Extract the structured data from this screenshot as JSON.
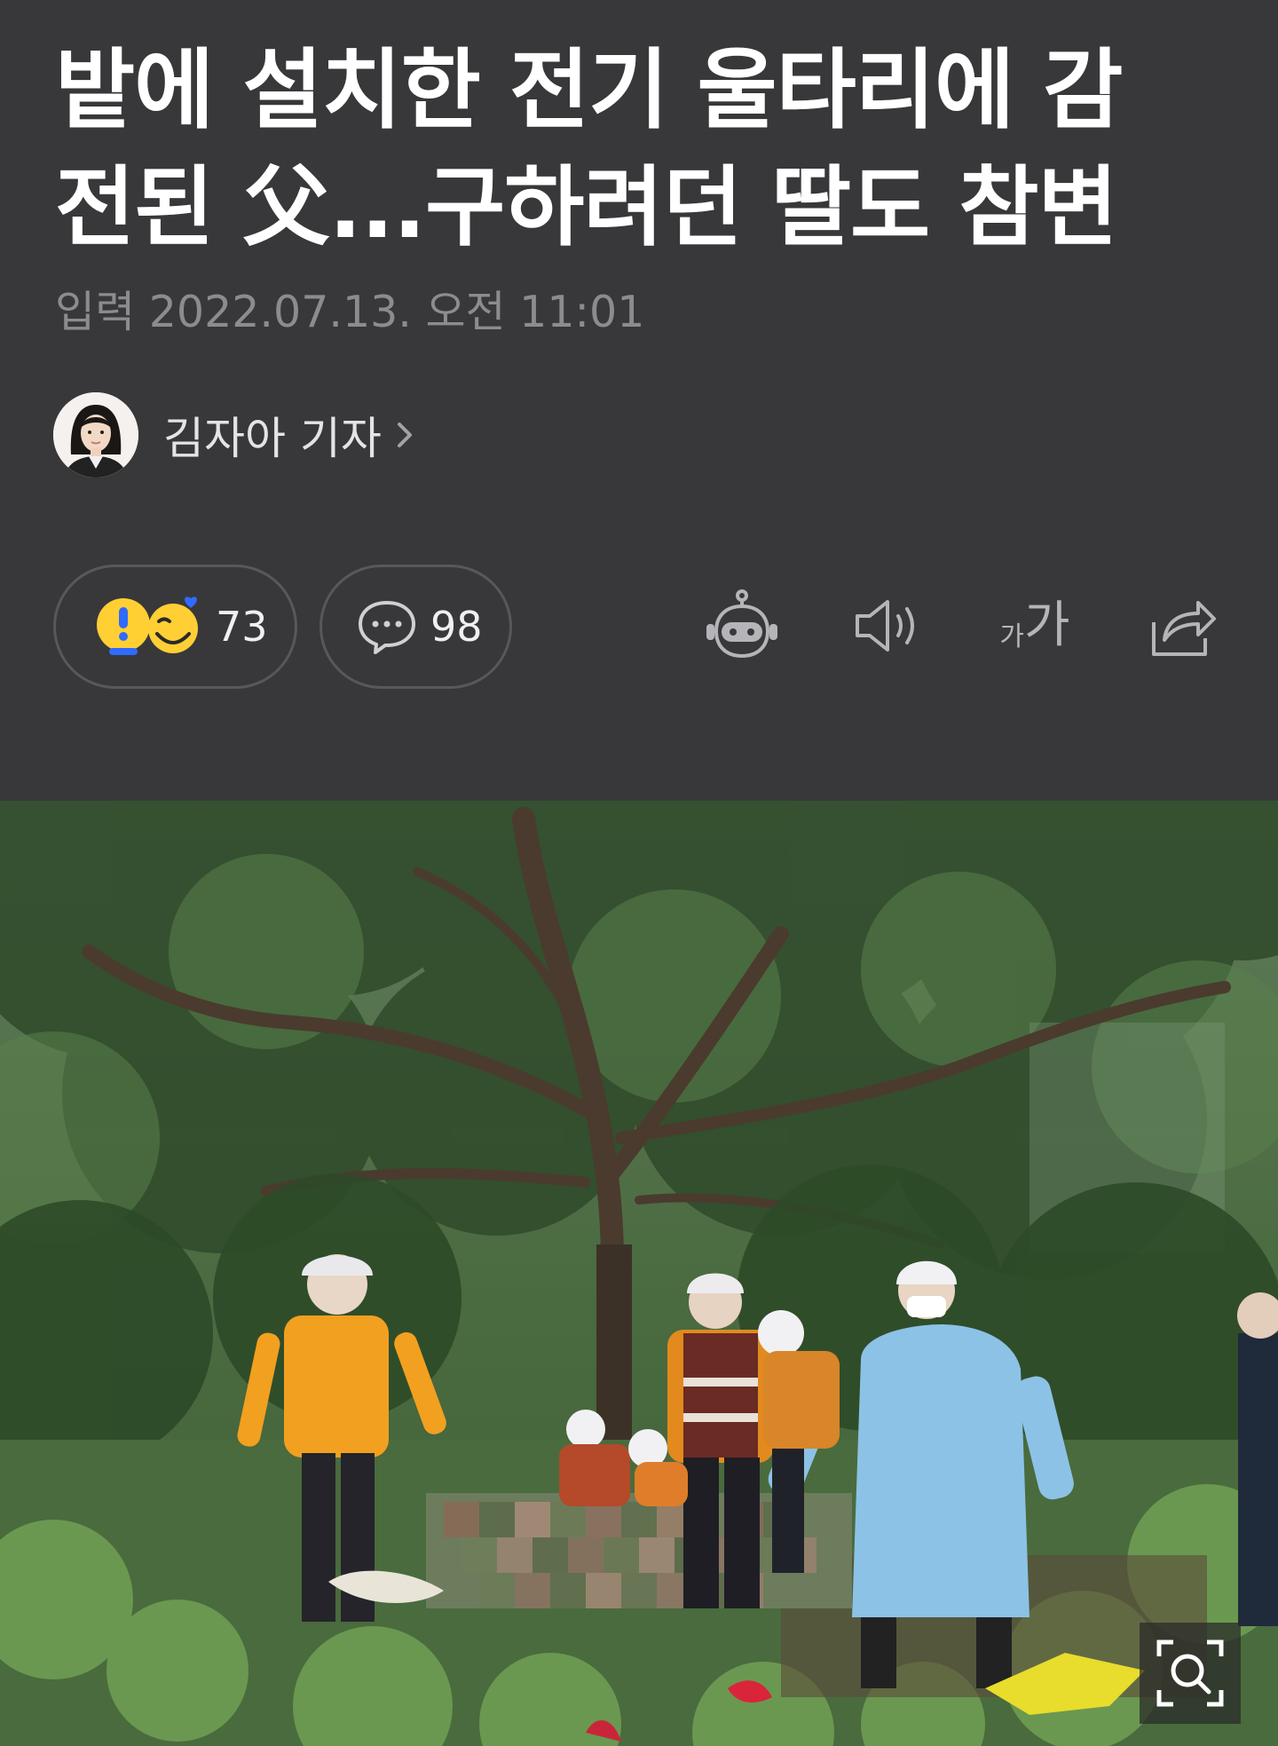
{
  "article": {
    "title_line1": "밭에 설치한 전기 울타리에 감",
    "title_line2": "전된 父...구하려던 딸도 참변",
    "date": "입력 2022.07.13. 오전 11:01"
  },
  "author": {
    "name": "김자아 기자",
    "avatar_icon": "reporter-portrait"
  },
  "reactions": {
    "count": "73",
    "icons": [
      "surprise-emoji-icon",
      "heart-smile-emoji-icon"
    ]
  },
  "comments": {
    "count": "98",
    "icon": "speech-bubble-icon"
  },
  "toolbar": {
    "icons": [
      "robot-summary-icon",
      "speaker-icon",
      "font-size-icon",
      "share-icon"
    ],
    "font_size_small": "가",
    "font_size_large": "가"
  },
  "photo": {
    "zoom_icon": "zoom-search-icon"
  },
  "colors": {
    "background": "#38383b",
    "title": "#ffffff",
    "date": "#8c8c90",
    "pill_border": "#58585c"
  }
}
